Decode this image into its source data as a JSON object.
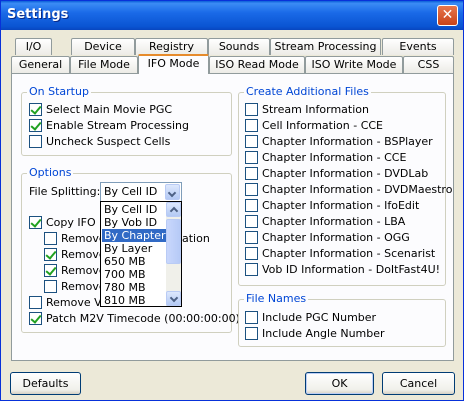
{
  "window": {
    "title": "Settings"
  },
  "tabs_back": [
    "I/O",
    "Device",
    "Registry",
    "Sounds",
    "Stream Processing",
    "Events"
  ],
  "tabs_front": [
    "General",
    "File Mode",
    "IFO Mode",
    "ISO Read Mode",
    "ISO Write Mode",
    "CSS"
  ],
  "active_tab": "IFO Mode",
  "on_startup": {
    "legend": "On Startup",
    "items": [
      {
        "label": "Select Main Movie PGC",
        "checked": true
      },
      {
        "label": "Enable Stream Processing",
        "checked": true
      },
      {
        "label": "Uncheck Suspect Cells",
        "checked": false
      }
    ]
  },
  "options": {
    "legend": "Options",
    "file_splitting_label": "File Splitting:",
    "file_splitting_value": "By Cell ID",
    "dropdown_options": [
      "By Cell ID",
      "By Vob ID",
      "By Chapter",
      "By Layer",
      "650 MB",
      "700 MB",
      "780 MB",
      "810 MB"
    ],
    "dropdown_highlighted": "By Chapter",
    "copy_ifo_label": "Copy IFO F",
    "copy_ifo_checked": true,
    "sub_items": [
      {
        "label": "Remove",
        "checked": false
      },
      {
        "label": "Remove",
        "checked": true
      },
      {
        "label": "Remove",
        "checked": true
      },
      {
        "label": "Remove",
        "checked": false
      }
    ],
    "sub_item_tail": "ation",
    "remove_vo_label": "Remove VO",
    "remove_vo_checked": false,
    "patch_label": "Patch M2V Timecode (00:00:00:00)",
    "patch_checked": true
  },
  "create_files": {
    "legend": "Create Additional Files",
    "items": [
      {
        "label": "Stream Information",
        "checked": false
      },
      {
        "label": "Cell Information - CCE",
        "checked": false
      },
      {
        "label": "Chapter Information - BSPlayer",
        "checked": false
      },
      {
        "label": "Chapter Information - CCE",
        "checked": false
      },
      {
        "label": "Chapter Information - DVDLab",
        "checked": false
      },
      {
        "label": "Chapter Information - DVDMaestro",
        "checked": false
      },
      {
        "label": "Chapter Information - IfoEdit",
        "checked": false
      },
      {
        "label": "Chapter Information - LBA",
        "checked": false
      },
      {
        "label": "Chapter Information - OGG",
        "checked": false
      },
      {
        "label": "Chapter Information - Scenarist",
        "checked": false
      },
      {
        "label": "Vob ID Information - DoItFast4U!",
        "checked": false
      }
    ]
  },
  "file_names": {
    "legend": "File Names",
    "items": [
      {
        "label": "Include PGC Number",
        "checked": false
      },
      {
        "label": "Include Angle Number",
        "checked": false
      }
    ]
  },
  "buttons": {
    "defaults": "Defaults",
    "ok": "OK",
    "cancel": "Cancel"
  }
}
